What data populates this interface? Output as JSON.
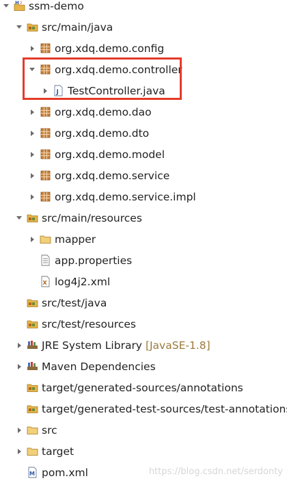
{
  "tree": [
    {
      "label": "ssm-demo",
      "icon": "maven-project-icon",
      "state": "expanded",
      "depth": 0
    },
    {
      "label": "src/main/java",
      "icon": "source-folder-icon",
      "state": "expanded",
      "depth": 1
    },
    {
      "label": "org.xdq.demo.config",
      "icon": "package-icon",
      "state": "collapsed",
      "depth": 2
    },
    {
      "label": "org.xdq.demo.controller",
      "icon": "package-icon",
      "state": "expanded",
      "depth": 2
    },
    {
      "label": "TestController.java",
      "icon": "java-file-icon",
      "state": "collapsed",
      "depth": 3
    },
    {
      "label": "org.xdq.demo.dao",
      "icon": "package-icon",
      "state": "collapsed",
      "depth": 2
    },
    {
      "label": "org.xdq.demo.dto",
      "icon": "package-icon",
      "state": "collapsed",
      "depth": 2
    },
    {
      "label": "org.xdq.demo.model",
      "icon": "package-icon",
      "state": "collapsed",
      "depth": 2
    },
    {
      "label": "org.xdq.demo.service",
      "icon": "package-icon",
      "state": "collapsed",
      "depth": 2
    },
    {
      "label": "org.xdq.demo.service.impl",
      "icon": "package-icon",
      "state": "collapsed",
      "depth": 2
    },
    {
      "label": "src/main/resources",
      "icon": "source-folder-icon",
      "state": "expanded",
      "depth": 1
    },
    {
      "label": "mapper",
      "icon": "folder-icon",
      "state": "collapsed",
      "depth": 2
    },
    {
      "label": "app.properties",
      "icon": "properties-file-icon",
      "state": "leaf",
      "depth": 2
    },
    {
      "label": "log4j2.xml",
      "icon": "xml-file-icon",
      "state": "leaf",
      "depth": 2
    },
    {
      "label": "src/test/java",
      "icon": "source-folder-icon",
      "state": "leaf",
      "depth": 1
    },
    {
      "label": "src/test/resources",
      "icon": "source-folder-icon",
      "state": "leaf",
      "depth": 1
    },
    {
      "label": "JRE System Library",
      "decoration": "[JavaSE-1.8]",
      "icon": "library-icon",
      "state": "collapsed",
      "depth": 1
    },
    {
      "label": "Maven Dependencies",
      "icon": "library-icon",
      "state": "collapsed",
      "depth": 1
    },
    {
      "label": "target/generated-sources/annotations",
      "icon": "source-folder-icon",
      "state": "leaf",
      "depth": 1
    },
    {
      "label": "target/generated-test-sources/test-annotations",
      "icon": "source-folder-icon",
      "state": "leaf",
      "depth": 1
    },
    {
      "label": "src",
      "icon": "folder-icon",
      "state": "collapsed",
      "depth": 1
    },
    {
      "label": "target",
      "icon": "folder-icon",
      "state": "collapsed",
      "depth": 1
    },
    {
      "label": "pom.xml",
      "icon": "maven-pom-icon",
      "state": "leaf",
      "depth": 1
    }
  ],
  "watermark": "https://blog.csdn.net/serdonty",
  "colors": {
    "highlight": "#e53a28",
    "package": "#b5651d",
    "folder": "#e6b54a",
    "decoration": "#9c7a3c"
  }
}
